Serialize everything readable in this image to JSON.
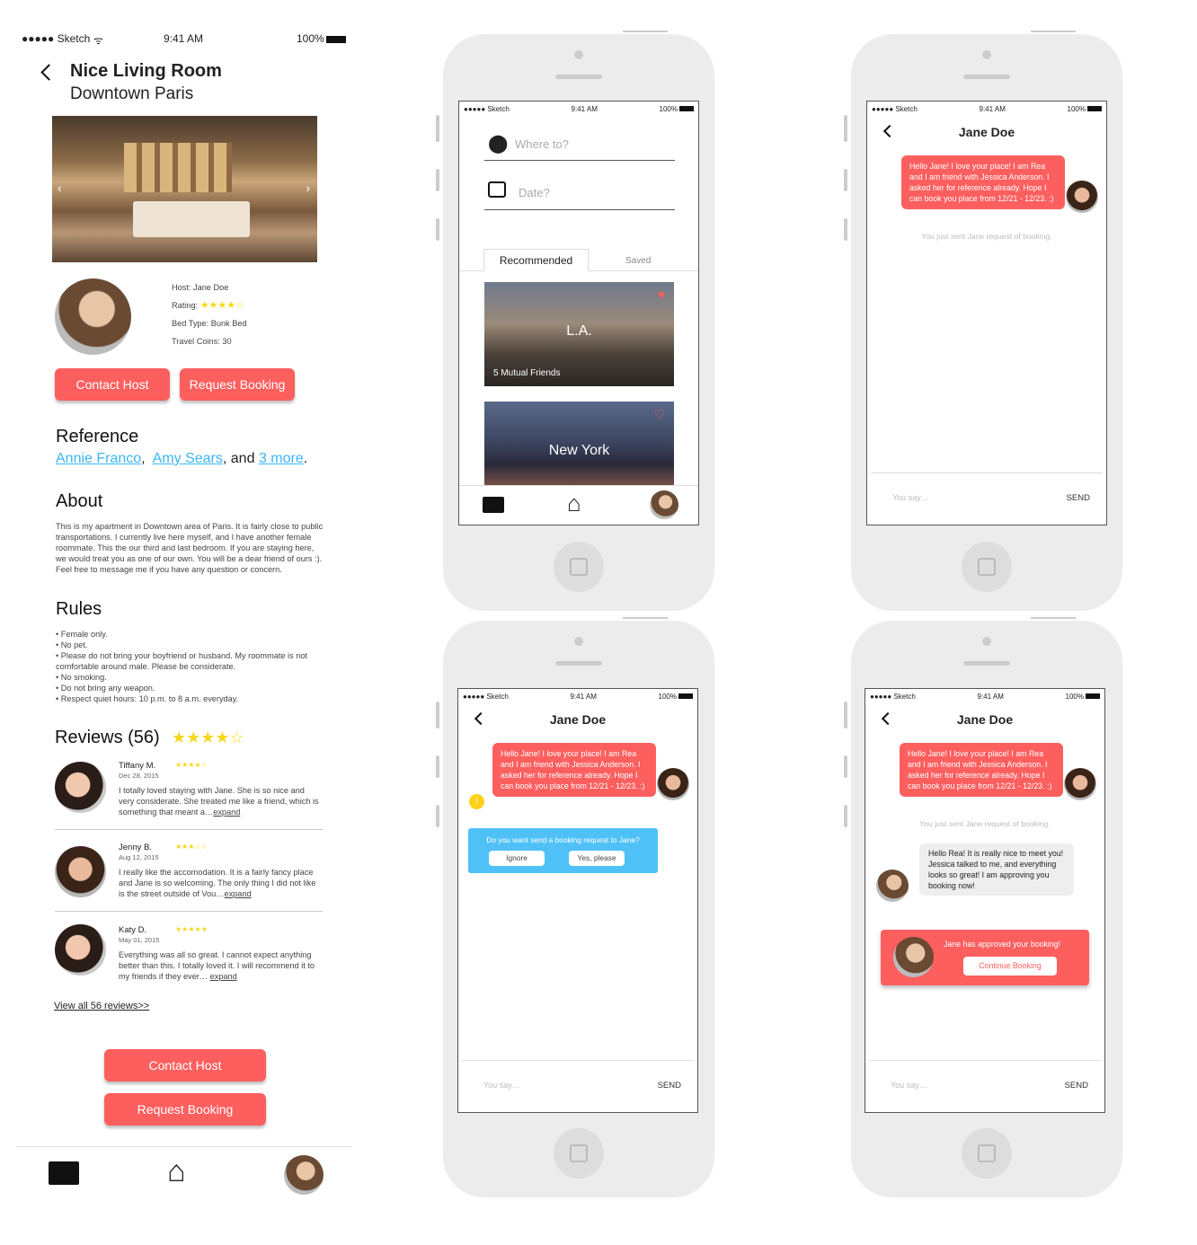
{
  "status": {
    "carrier": "●●●●● Sketch",
    "wifi_icon": "wifi-icon",
    "time": "9:41 AM",
    "battery": "100%"
  },
  "listing": {
    "title": "Nice Living Room",
    "subtitle": "Downtown Paris",
    "host": "Host: Jane Doe",
    "rating_label": "Rating:",
    "rating": 4,
    "rating_stars": "★★★★☆",
    "bed": "Bed Type: Bunk Bed",
    "coins": "Travel Coins: 30",
    "contact": "Contact Host",
    "request": "Request Booking",
    "reference_title": "Reference",
    "ref1": "Annie Franco",
    "ref_sep1": ",",
    "ref2": "Amy Sears",
    "ref_and": ", and",
    "ref3": "3 more",
    "ref_end": ".",
    "about_title": "About",
    "about": "This is my apartment in Downtown area of Paris. It is fairly close to public transportations. I currently live here myself, and I have another female roommate. This the our third and last bedroom. If you are staying here, we would treat you as one of our own. You will be a dear friend of ours :). Feel free to message me if you have any question or concern.",
    "rules_title": "Rules",
    "rules": [
      "• Female only.",
      "• No pet.",
      "• Please do not bring your boyfriend or husband. My roommate is not comfortable around male. Please be considerate.",
      "• No smoking.",
      "• Do not bring any weapon.",
      "• Respect quiet hours: 10 p.m. to 8 a.m. everyday."
    ],
    "reviews_title": "Reviews (56)",
    "reviews_stars": "★★★★☆",
    "reviews": [
      {
        "name": "Tiffany M.",
        "date": "Dec 28, 2015",
        "stars": "★★★★☆",
        "rating": 4,
        "text": "I totally loved staying with Jane. She is so nice and very considerate. She treated me like a friend, which is something that meant a…",
        "expand": "expand"
      },
      {
        "name": "Jenny B.",
        "date": "Aug 12, 2015",
        "stars": "★★★☆☆",
        "rating": 3,
        "text": "I really like the accomodation. It is a fairly fancy place and Jane is so welcoming. The only thing I did not like is the street outside of Vou…",
        "expand": "expand"
      },
      {
        "name": "Katy D.",
        "date": "May 01, 2015",
        "stars": "★★★★★",
        "rating": 5,
        "text": "Everything was all so great. I cannot expect anything better than this. I totally loved it. I will recommend it to my friends if they ever… ",
        "expand": "expand"
      }
    ],
    "view_all": "View all 56 reviews>>"
  },
  "search": {
    "where_placeholder": "Where to?",
    "date_placeholder": "Date?",
    "tab_recommended": "Recommended",
    "tab_saved": "Saved",
    "cards": [
      {
        "city": "L.A.",
        "friends": "5 Mutual Friends",
        "saved": true
      },
      {
        "city": "New York",
        "saved": false
      }
    ]
  },
  "chat": {
    "title": "Jane Doe",
    "message": "Hello Jane! I love your place! I am Rea and I am friend with Jessica Anderson. I asked her for reference already. Hope I can book you place from 12/21 - 12/23. :)",
    "notice": "You just sent Jane request of booking.",
    "placeholder": "You say…",
    "send": "SEND",
    "prompt": "Do you want send a booking request to Jane?",
    "ignore": "Ignore",
    "yes": "Yes, please",
    "warning": "!",
    "reply": "Hello Rea! It is really nice to meet you! Jessica talked to me, and everything looks so great! I am approving you booking now!",
    "approved": "Jane has approved your booking!",
    "continue": "Continue Booking"
  },
  "colors": {
    "accent": "#fd5f5f",
    "link": "#3ab5f5",
    "prompt": "#4fc1f7",
    "star": "#f5d81b"
  }
}
